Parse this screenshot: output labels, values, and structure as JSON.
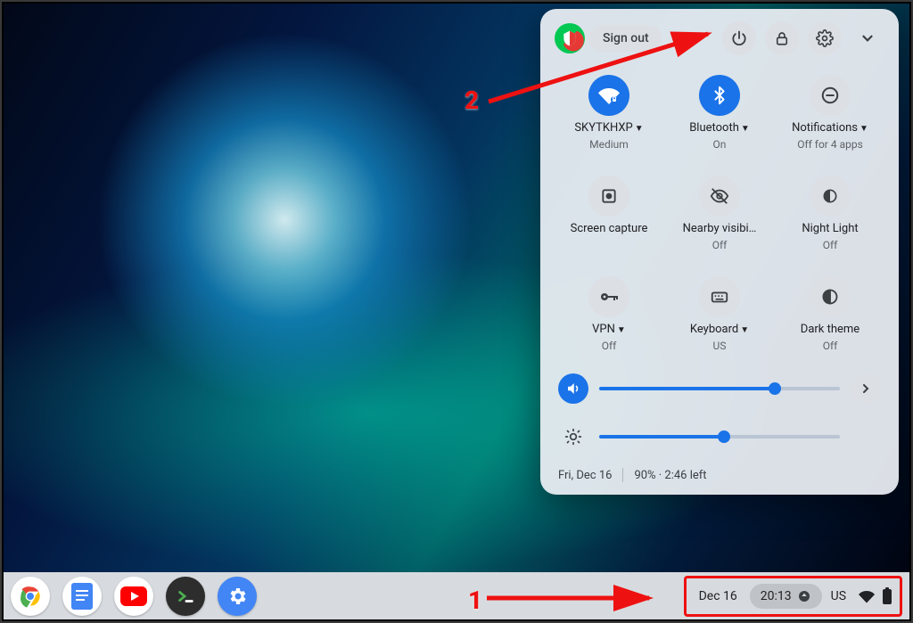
{
  "header": {
    "signout_label": "Sign out"
  },
  "tiles": {
    "wifi": {
      "label": "SKYTKHXP",
      "sub": "Medium",
      "dropdown": true,
      "on": true
    },
    "bluetooth": {
      "label": "Bluetooth",
      "sub": "On",
      "dropdown": true,
      "on": true
    },
    "notifications": {
      "label": "Notifications",
      "sub": "Off for 4 apps",
      "dropdown": true,
      "on": false
    },
    "capture": {
      "label": "Screen capture",
      "sub": "",
      "on": false
    },
    "nearby": {
      "label": "Nearby visibi…",
      "sub": "Off",
      "on": false
    },
    "nightlight": {
      "label": "Night Light",
      "sub": "Off",
      "on": false
    },
    "vpn": {
      "label": "VPN",
      "sub": "Off",
      "dropdown": true,
      "on": false
    },
    "keyboard": {
      "label": "Keyboard",
      "sub": "US",
      "dropdown": true,
      "on": false
    },
    "darktheme": {
      "label": "Dark theme",
      "sub": "Off",
      "on": false
    }
  },
  "sliders": {
    "volume_pct": 73,
    "brightness_pct": 52
  },
  "footer": {
    "date_long": "Fri, Dec 16",
    "battery_status": "90% · 2:46 left"
  },
  "shelf": {
    "date_short": "Dec 16",
    "time": "20:13",
    "ime": "US"
  },
  "annotations": {
    "one": "1",
    "two": "2"
  }
}
